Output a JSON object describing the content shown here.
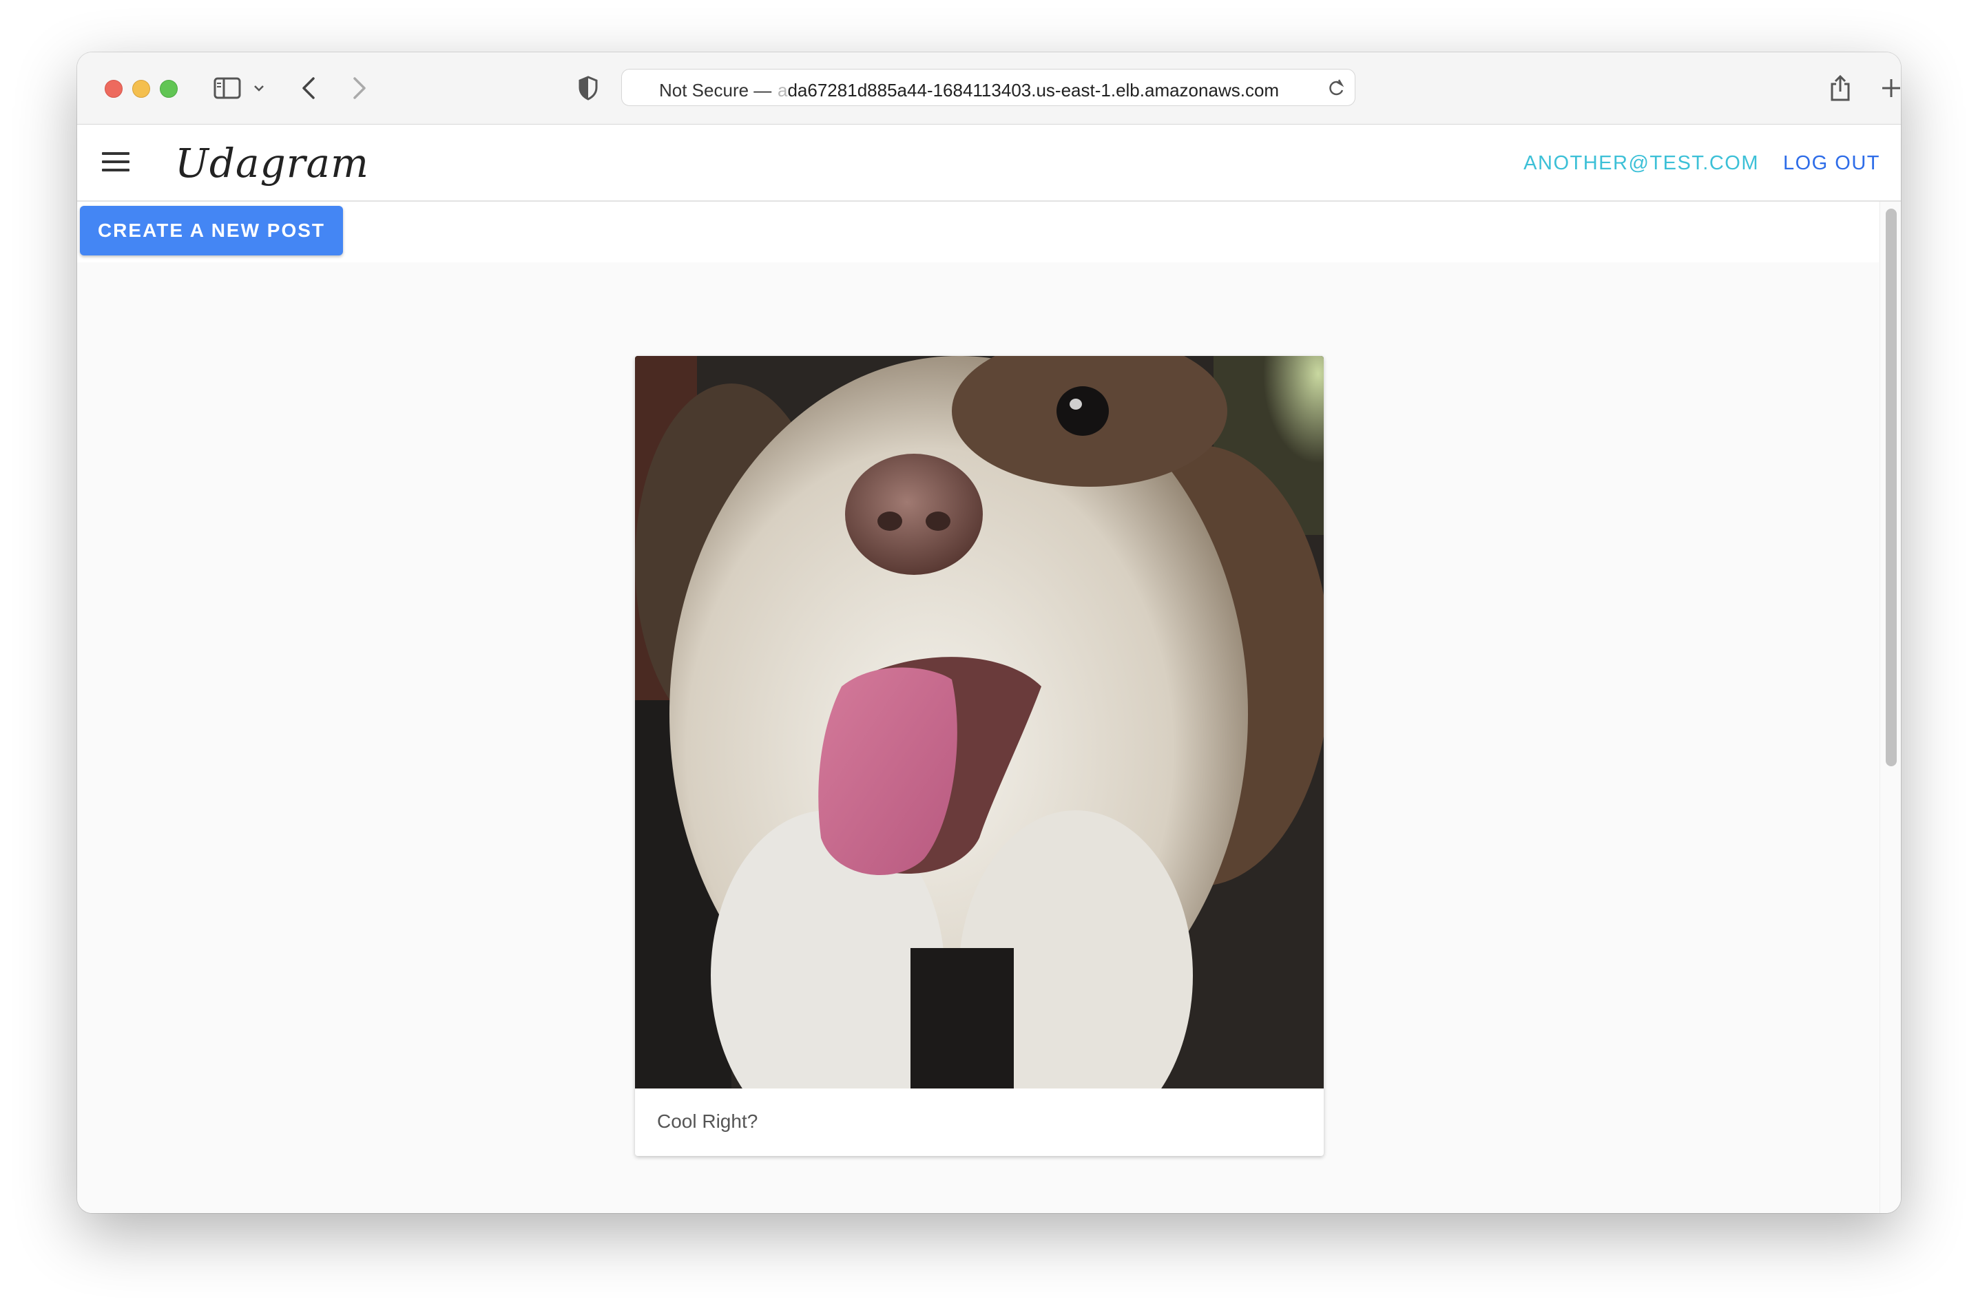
{
  "browser": {
    "address_prefix": "Not Secure —",
    "address_fade": "a",
    "address_url": "da67281d885a44-1684113403.us-east-1.elb.amazonaws.com"
  },
  "app": {
    "logo": "Udagram",
    "user_email": "ANOTHER@TEST.COM",
    "logout_label": "LOG OUT",
    "create_post_label": "CREATE A NEW POST"
  },
  "feed": {
    "posts": [
      {
        "caption": "Cool Right?"
      }
    ]
  },
  "colors": {
    "accent_blue": "#4486f4",
    "email_cyan": "#3cc0d7",
    "logout_blue": "#2d6ce8"
  }
}
